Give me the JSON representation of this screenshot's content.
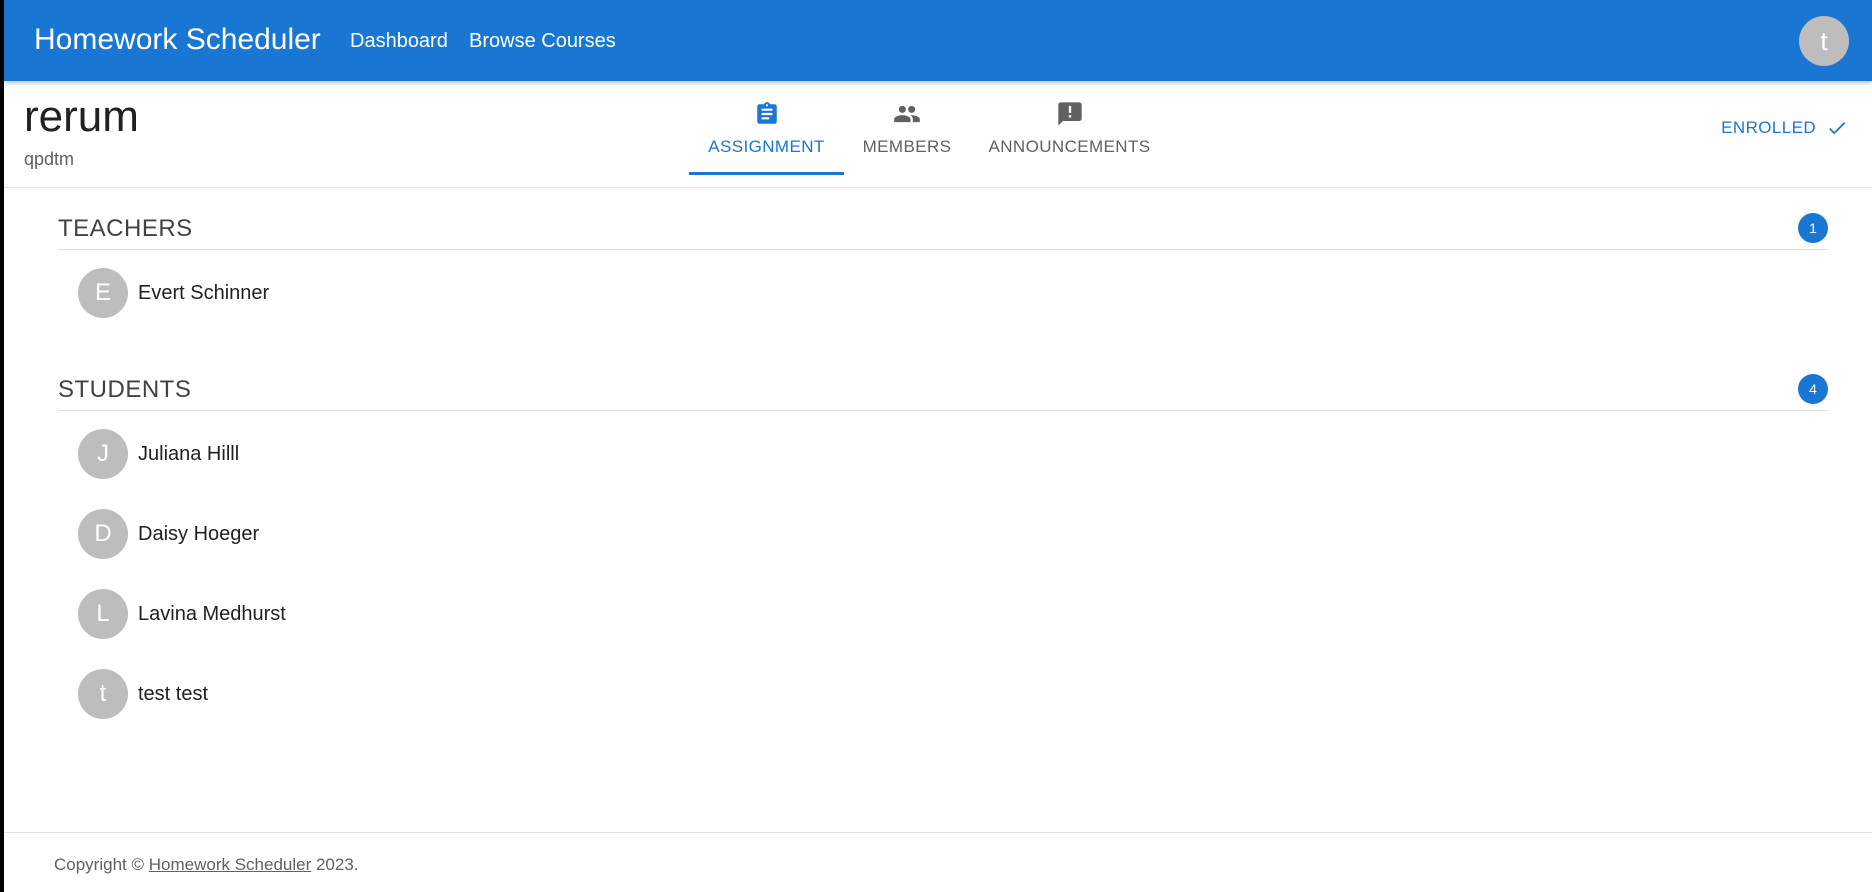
{
  "appbar": {
    "title": "Homework Scheduler",
    "nav": [
      {
        "label": "Dashboard"
      },
      {
        "label": "Browse Courses"
      }
    ],
    "user_initial": "t"
  },
  "course": {
    "title": "rerum",
    "subtitle": "qpdtm",
    "tabs": [
      {
        "label": "ASSIGNMENT",
        "icon": "clipboard-icon",
        "active": true
      },
      {
        "label": "MEMBERS",
        "icon": "people-icon",
        "active": false
      },
      {
        "label": "ANNOUNCEMENTS",
        "icon": "announcement-icon",
        "active": false
      }
    ],
    "enrolled_label": "ENROLLED"
  },
  "teachers": {
    "title": "TEACHERS",
    "count": "1",
    "members": [
      {
        "initial": "E",
        "name": "Evert Schinner"
      }
    ]
  },
  "students": {
    "title": "STUDENTS",
    "count": "4",
    "members": [
      {
        "initial": "J",
        "name": "Juliana Hilll"
      },
      {
        "initial": "D",
        "name": "Daisy Hoeger"
      },
      {
        "initial": "L",
        "name": "Lavina Medhurst"
      },
      {
        "initial": "t",
        "name": "test test"
      }
    ]
  },
  "footer": {
    "prefix": "Copyright © ",
    "link": "Homework Scheduler",
    "suffix": " 2023."
  },
  "colors": {
    "primary": "#1976d2",
    "avatar_bg": "#bdbdbd"
  }
}
